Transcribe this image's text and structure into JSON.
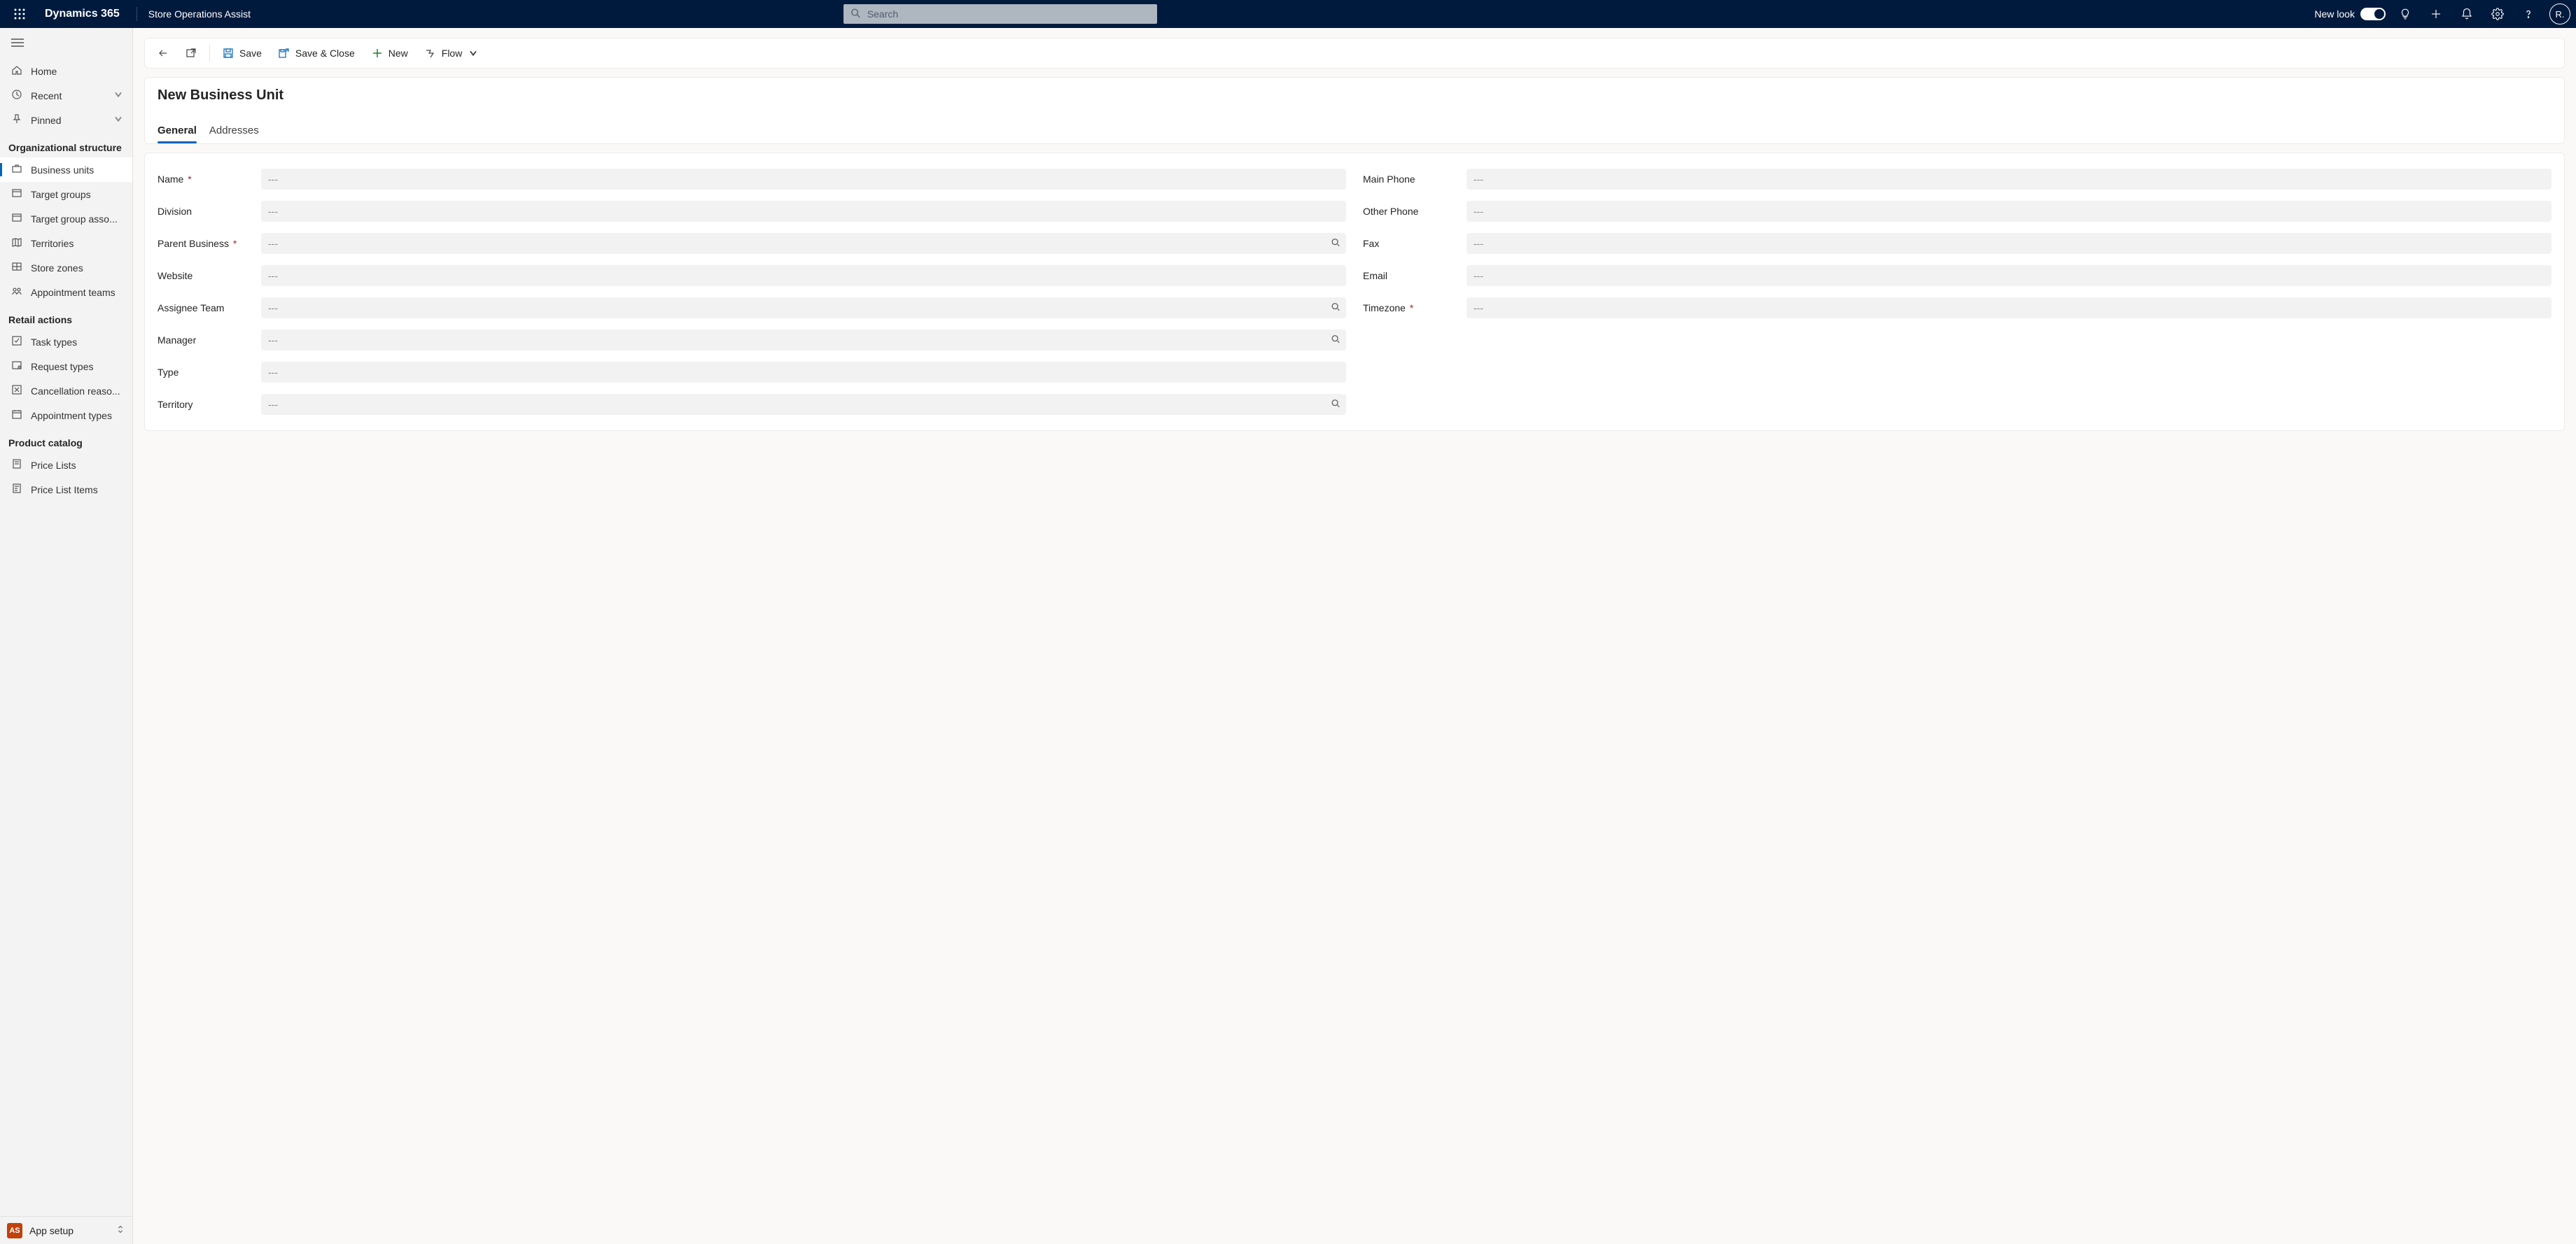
{
  "top": {
    "brand": "Dynamics 365",
    "app": "Store Operations Assist",
    "search_placeholder": "Search",
    "new_look": "New look",
    "avatar_initials": "R."
  },
  "sidebar": {
    "top": [
      {
        "icon": "home",
        "label": "Home",
        "chev": false
      },
      {
        "icon": "clock",
        "label": "Recent",
        "chev": true
      },
      {
        "icon": "pin",
        "label": "Pinned",
        "chev": true
      }
    ],
    "groups": [
      {
        "title": "Organizational structure",
        "items": [
          {
            "icon": "briefcase",
            "label": "Business units",
            "selected": true
          },
          {
            "icon": "target",
            "label": "Target groups"
          },
          {
            "icon": "target",
            "label": "Target group asso..."
          },
          {
            "icon": "map",
            "label": "Territories"
          },
          {
            "icon": "zone",
            "label": "Store zones"
          },
          {
            "icon": "team",
            "label": "Appointment teams"
          }
        ]
      },
      {
        "title": "Retail actions",
        "items": [
          {
            "icon": "tasktype",
            "label": "Task types"
          },
          {
            "icon": "request",
            "label": "Request types"
          },
          {
            "icon": "cancel",
            "label": "Cancellation reaso..."
          },
          {
            "icon": "appointment",
            "label": "Appointment types"
          }
        ]
      },
      {
        "title": "Product catalog",
        "items": [
          {
            "icon": "pricelist",
            "label": "Price Lists"
          },
          {
            "icon": "pricelistitem",
            "label": "Price List Items"
          }
        ]
      }
    ],
    "switcher": {
      "badge": "AS",
      "name": "App setup"
    }
  },
  "commands": {
    "save": "Save",
    "save_close": "Save & Close",
    "new": "New",
    "flow": "Flow"
  },
  "record": {
    "title": "New Business Unit",
    "tabs": [
      {
        "label": "General",
        "active": true
      },
      {
        "label": "Addresses",
        "active": false
      }
    ]
  },
  "form": {
    "placeholder": "---",
    "left": [
      {
        "label": "Name",
        "required": true,
        "lookup": false
      },
      {
        "label": "Division",
        "required": false,
        "lookup": false
      },
      {
        "label": "Parent Business",
        "required": true,
        "lookup": true
      },
      {
        "label": "Website",
        "required": false,
        "lookup": false
      },
      {
        "label": "Assignee Team",
        "required": false,
        "lookup": true
      },
      {
        "label": "Manager",
        "required": false,
        "lookup": true
      },
      {
        "label": "Type",
        "required": false,
        "lookup": false
      },
      {
        "label": "Territory",
        "required": false,
        "lookup": true
      }
    ],
    "right": [
      {
        "label": "Main Phone",
        "required": false,
        "lookup": false
      },
      {
        "label": "Other Phone",
        "required": false,
        "lookup": false
      },
      {
        "label": "Fax",
        "required": false,
        "lookup": false
      },
      {
        "label": "Email",
        "required": false,
        "lookup": false
      },
      {
        "label": "Timezone",
        "required": true,
        "lookup": false
      }
    ]
  }
}
